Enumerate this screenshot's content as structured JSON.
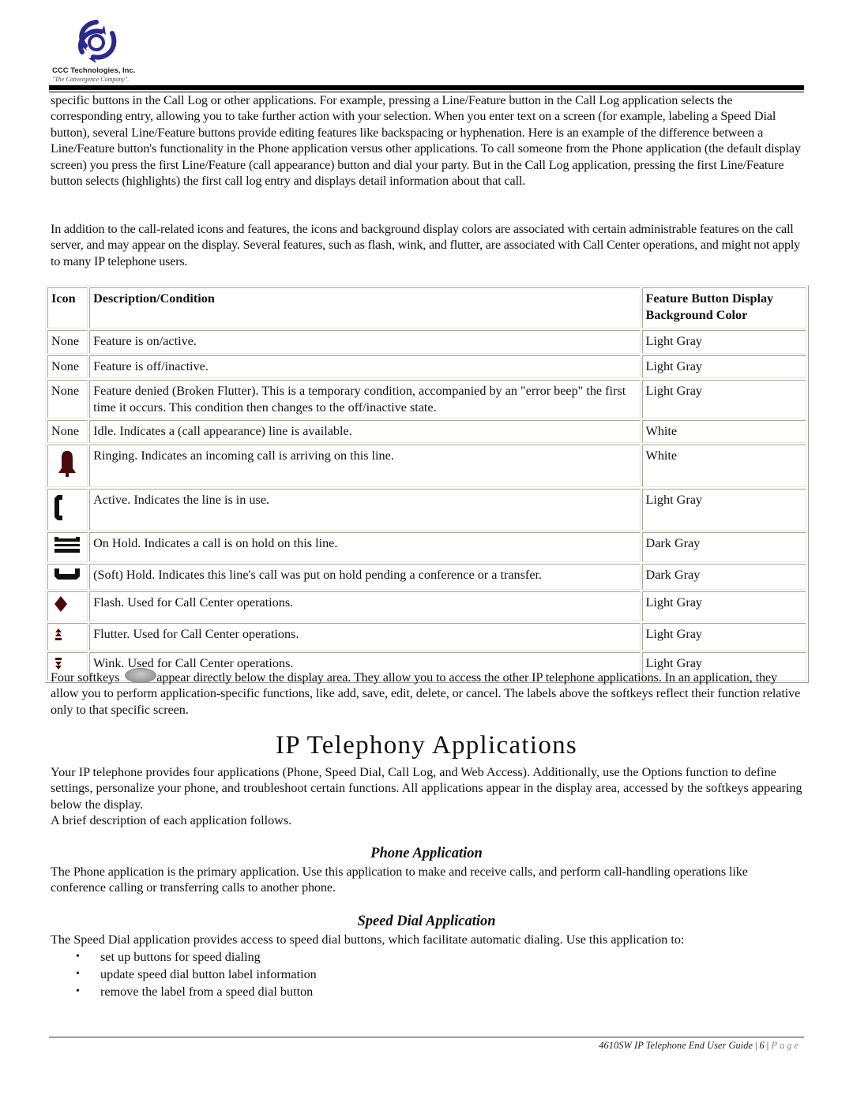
{
  "header": {
    "company": "CCC Technologies, Inc.",
    "tagline": "\"The Convergence Company\"."
  },
  "intro_paragraphs": [
    "specific buttons in the Call Log or other applications. For example, pressing a Line/Feature button in the Call Log application selects the corresponding entry, allowing you to take further action with your selection. When you enter text on a screen (for example, labeling a Speed Dial button), several Line/Feature buttons provide editing features like backspacing or hyphenation. Here is an example of the difference between a Line/Feature button's functionality in the Phone application versus other applications. To call someone from the Phone application (the default display screen) you press the first Line/Feature (call appearance) button and dial your party. But in the Call Log application, pressing the first Line/Feature button selects (highlights) the first call log entry and displays detail information about that call.",
    "In addition to the call-related icons and features, the icons and background display colors are associated with certain administrable features on the call server, and may appear on the display. Several features, such as flash, wink, and flutter, are associated with Call Center operations, and might not apply to many IP telephone users."
  ],
  "table": {
    "headers": [
      "Icon",
      "Description/Condition",
      "Feature Button Display Background Color"
    ],
    "rows": [
      {
        "icon": "None",
        "icon_name": "",
        "description": "Feature is on/active.",
        "color": "Light Gray"
      },
      {
        "icon": "None",
        "icon_name": "",
        "description": "Feature is off/inactive.",
        "color": "Light Gray"
      },
      {
        "icon": "None",
        "icon_name": "",
        "description": "Feature denied (Broken Flutter). This is a temporary condition, accompanied by an \"error beep\" the first time it occurs. This condition then changes to the off/inactive state.",
        "color": "Light Gray"
      },
      {
        "icon": "None",
        "icon_name": "",
        "description": "Idle. Indicates a (call appearance) line is available.",
        "color": "White"
      },
      {
        "icon": "",
        "icon_name": "bell-icon",
        "description": "Ringing. Indicates an incoming call is arriving on this line.",
        "color": "White"
      },
      {
        "icon": "",
        "icon_name": "handset-active-icon",
        "description": "Active. Indicates the line is in use.",
        "color": "Light Gray"
      },
      {
        "icon": "",
        "icon_name": "handset-hold-icon",
        "description": "On Hold. Indicates a call is on hold on this line.",
        "color": "Dark Gray"
      },
      {
        "icon": "",
        "icon_name": "handset-soft-hold-icon",
        "description": "(Soft) Hold. Indicates this line's call was put on hold pending a conference or a transfer.",
        "color": "Dark Gray"
      },
      {
        "icon": "",
        "icon_name": "diamond-flash-icon",
        "description": "Flash. Used for Call Center operations.",
        "color": "Light Gray"
      },
      {
        "icon": "",
        "icon_name": "flutter-arrows-icon",
        "description": "Flutter. Used for Call Center operations.",
        "color": "Light Gray"
      },
      {
        "icon": "",
        "icon_name": "wink-arrows-icon",
        "description": "Wink. Used for Call Center operations.",
        "color": "Light Gray"
      }
    ]
  },
  "softkeys_paragraph": {
    "before": "Four softkeys ",
    "icon_name": "softkey-icon",
    "after": "appear directly below the display area. They allow you to access the other IP telephone applications. In an application, they allow you to perform application-specific functions, like add, save, edit, delete, or cancel. The labels above the softkeys reflect their function relative only to that specific screen."
  },
  "section": {
    "title": "IP Telephony Applications",
    "intro": "Your IP telephone provides four applications (Phone, Speed Dial, Call Log, and Web Access). Additionally, use the Options function to define settings, personalize your phone, and troubleshoot certain functions. All applications appear in the display area, accessed by the softkeys appearing below the display.",
    "intro2": "A brief description of each application follows.",
    "phone_app": {
      "title": "Phone Application",
      "text": "The Phone application is the primary application. Use this application to make and receive calls, and perform call-handling operations like conference calling or transferring calls to another phone."
    },
    "speed_dial_app": {
      "title": "Speed Dial Application",
      "text": "The Speed Dial application provides access to speed dial buttons, which facilitate automatic dialing. Use this application to:",
      "bullets": [
        "set up buttons for speed dialing",
        "update speed dial button label information",
        "remove the label from a speed dial button"
      ]
    }
  },
  "footer": {
    "doc_title": "4610SW IP Telephone End User Guide",
    "page_number": "6",
    "page_word": "Page"
  },
  "colors": {
    "logo_blue": "#2b2a8c",
    "icon_maroon": "#4a0a0a"
  }
}
